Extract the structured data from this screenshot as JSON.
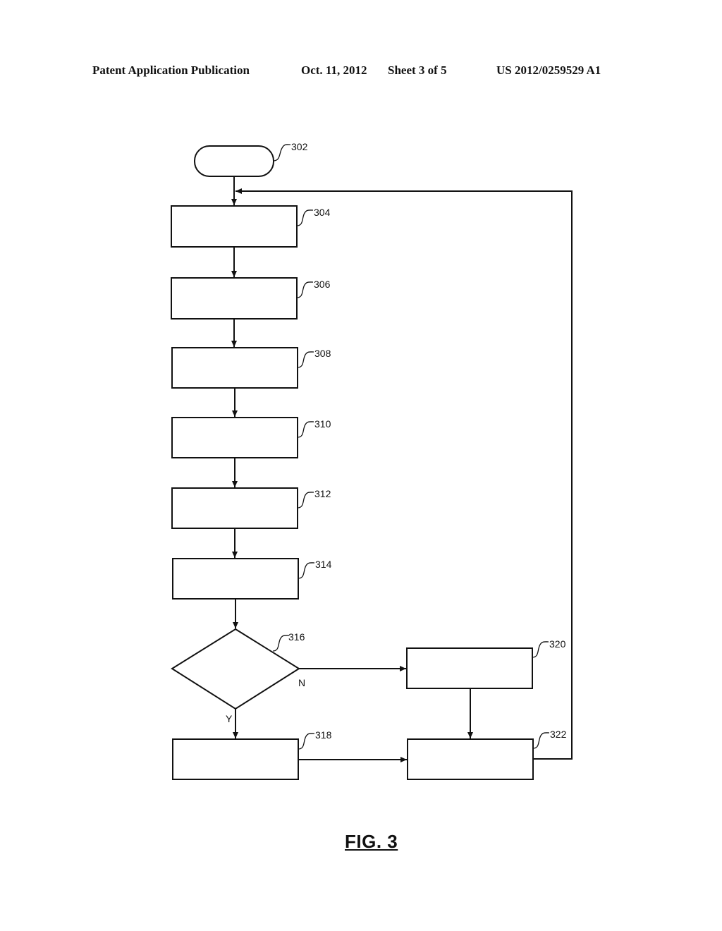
{
  "header": {
    "publication": "Patent Application Publication",
    "date": "Oct. 11, 2012",
    "sheet": "Sheet 3 of 5",
    "number": "US 2012/0259529 A1"
  },
  "flowchart": {
    "start": {
      "ref": "302",
      "shape": "terminator"
    },
    "steps": [
      {
        "ref": "304",
        "shape": "process"
      },
      {
        "ref": "306",
        "shape": "process"
      },
      {
        "ref": "308",
        "shape": "process"
      },
      {
        "ref": "310",
        "shape": "process"
      },
      {
        "ref": "312",
        "shape": "process"
      },
      {
        "ref": "314",
        "shape": "process"
      }
    ],
    "decision": {
      "ref": "316",
      "shape": "decision",
      "yes_label": "Y",
      "no_label": "N"
    },
    "yes_step": {
      "ref": "318",
      "shape": "process"
    },
    "no_step": {
      "ref": "320",
      "shape": "process"
    },
    "merge_step": {
      "ref": "322",
      "shape": "process"
    },
    "edges": [
      {
        "from": "302",
        "to": "304"
      },
      {
        "from": "304",
        "to": "306"
      },
      {
        "from": "306",
        "to": "308"
      },
      {
        "from": "308",
        "to": "310"
      },
      {
        "from": "310",
        "to": "312"
      },
      {
        "from": "312",
        "to": "314"
      },
      {
        "from": "314",
        "to": "316"
      },
      {
        "from": "316",
        "to": "318",
        "label": "Y"
      },
      {
        "from": "316",
        "to": "320",
        "label": "N"
      },
      {
        "from": "318",
        "to": "322"
      },
      {
        "from": "320",
        "to": "322"
      },
      {
        "from": "322",
        "to": "304"
      }
    ]
  },
  "figure": {
    "caption": "FIG. 3"
  }
}
